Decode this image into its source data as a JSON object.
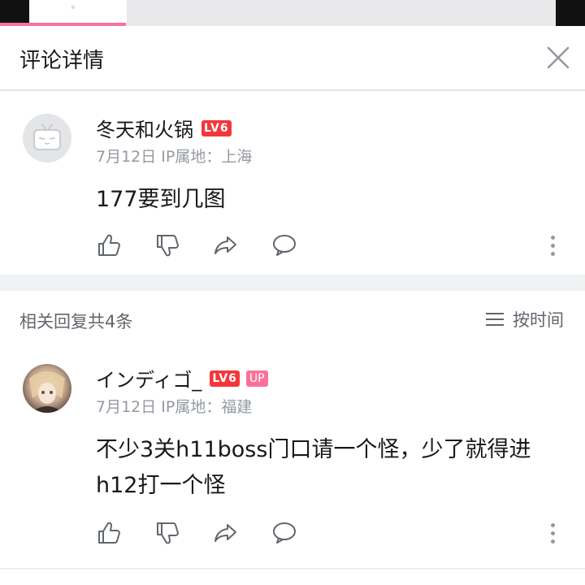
{
  "header": {
    "title": "评论详情",
    "close_icon": "close-icon"
  },
  "main_comment": {
    "username": "冬天和火锅",
    "level": "LV6",
    "meta": "7月12日 IP属地：上海",
    "content": "177要到几图"
  },
  "replies": {
    "count_label": "相关回复共4条",
    "sort_label": "按时间"
  },
  "reply_comment": {
    "username": "インディゴ_",
    "level": "LV6",
    "up_badge": "UP",
    "meta": "7月12日 IP属地：福建",
    "content": "不少3关h11boss门口请一个怪，少了就得进h12打一个怪"
  },
  "colors": {
    "accent_pink": "#fb7299",
    "level_red": "#f4363b",
    "text_gray": "#9499a0"
  }
}
